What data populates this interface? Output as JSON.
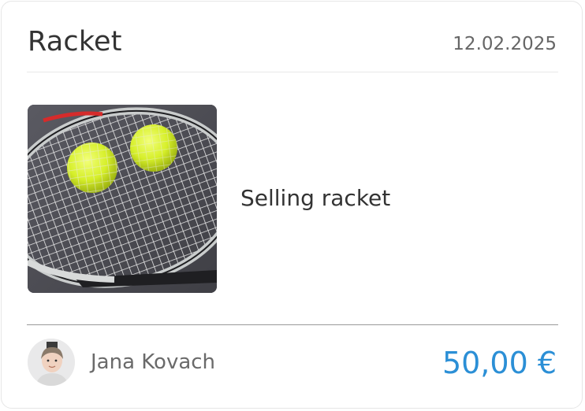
{
  "listing": {
    "title": "Racket",
    "date": "12.02.2025",
    "description": "Selling racket",
    "price": "50,00 €"
  },
  "seller": {
    "name": "Jana Kovach"
  },
  "colors": {
    "price": "#2b8fd6",
    "text": "#333333",
    "muted": "#666666"
  }
}
